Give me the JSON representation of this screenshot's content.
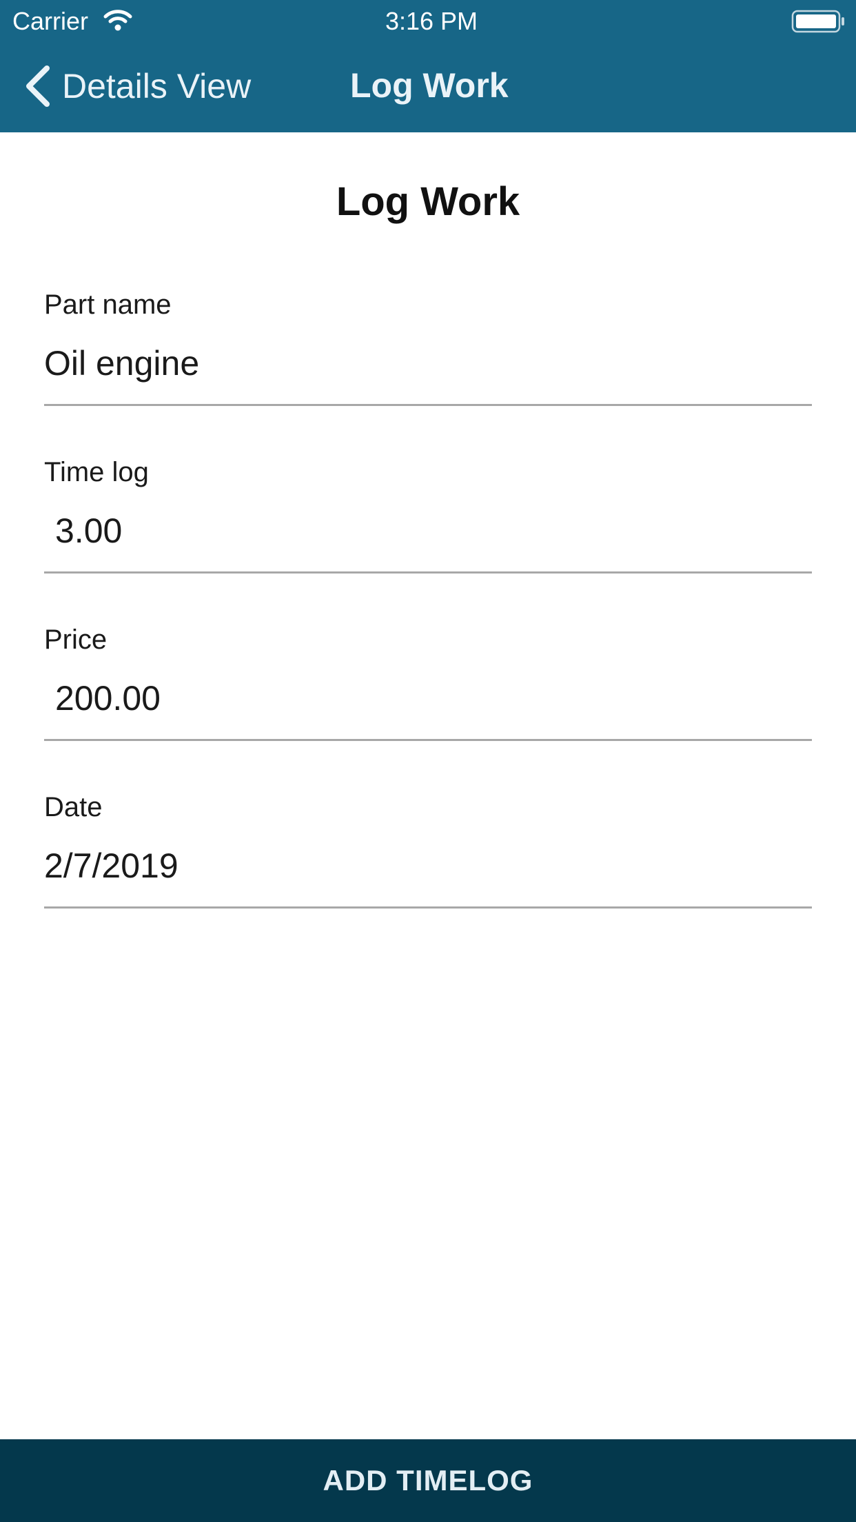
{
  "status_bar": {
    "carrier": "Carrier",
    "time": "3:16 PM"
  },
  "nav": {
    "back_label": "Details View",
    "title": "Log Work",
    "back_icon": "chevron-left-icon"
  },
  "form": {
    "heading": "Log Work",
    "fields": [
      {
        "label": "Part name",
        "value": "Oil engine"
      },
      {
        "label": "Time log",
        "value": "3.00"
      },
      {
        "label": "Price",
        "value": "200.00"
      },
      {
        "label": "Date",
        "value": "2/7/2019"
      }
    ]
  },
  "actions": {
    "add_timelog": "ADD TIMELOG"
  },
  "colors": {
    "header_bg": "#176687",
    "button_bg": "#04384c",
    "divider": "#a8a8a8"
  }
}
